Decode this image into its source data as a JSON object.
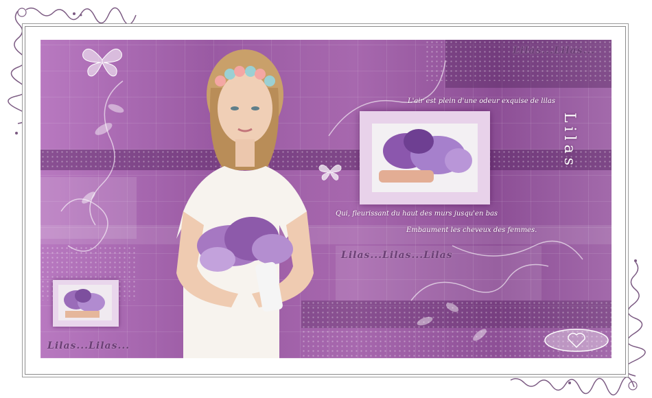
{
  "texts": {
    "top_right_lilas": "Lilas...Lilas...",
    "bottom_left_lilas": "Lilas...Lilas...",
    "center_lilas": "Lilas...Lilas...Lilas",
    "vertical_title": "Lilas",
    "poem_line_1": "L'air est plein d'une odeur exquise de lilas",
    "poem_line_2": "Qui, fleurissant du haut des murs jusqu'en bas",
    "poem_line_3": "Embaument les cheveux des femmes."
  },
  "colors": {
    "purple_main": "#9a5aa3",
    "purple_dark": "#6a3e74",
    "lilac_light": "#c89ad0",
    "white": "#ffffff"
  },
  "icons": {
    "butterfly_top_left": "butterfly-icon",
    "butterfly_center": "butterfly-icon",
    "signature_heart": "heart-icon"
  }
}
